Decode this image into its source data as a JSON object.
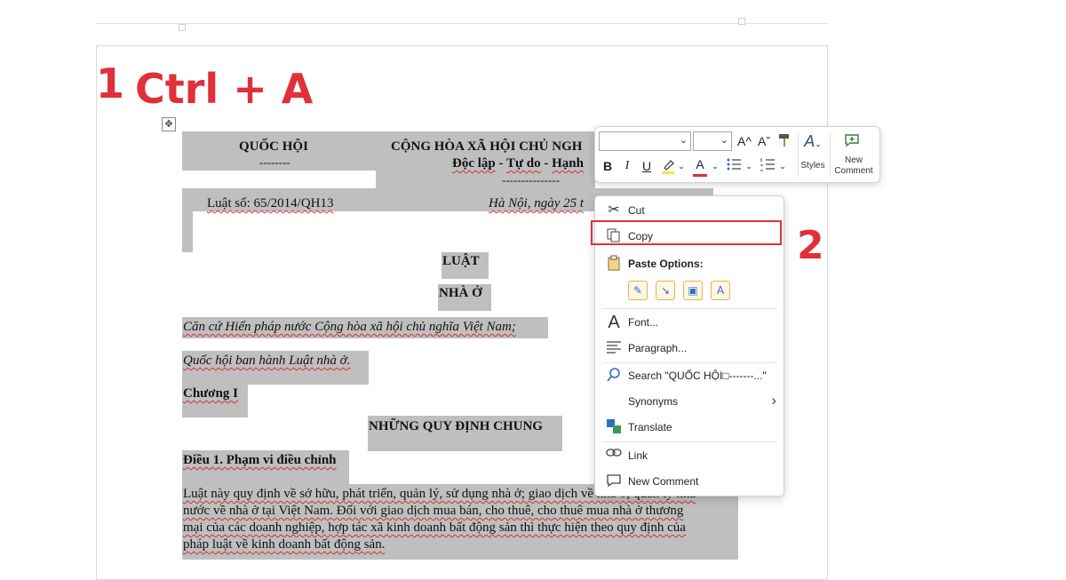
{
  "annotations": {
    "step1_number": "1",
    "step1_text": "Ctrl + A",
    "step2_number": "2"
  },
  "document": {
    "left_header_title": "QUỐC HỘI",
    "left_header_dashes": "--------",
    "right_header_title": "CỘNG HÒA XÃ HỘI CHỦ NGH",
    "motto_a": "Độc lập",
    "motto_dash1": " - ",
    "motto_b": "Tự do",
    "motto_dash2": " - ",
    "motto_c": "Hạnh",
    "motto_dashes": "---------------",
    "law_number": "Luật số: 65/2014/QH13",
    "place_date": "Hà Nội, ngày 25 t",
    "title_law": "LUẬT",
    "title_housing": "NHÀ Ở",
    "basis_line": "Căn cứ Hiến pháp nước Cộng hòa xã hội chủ nghĩa Việt Nam;",
    "enact_line": "Quốc hội ban hành Luật nhà ở.",
    "chapter": "Chương I",
    "chapter_title": "NHỮNG QUY ĐỊNH CHUNG",
    "article_title": "Điều 1. Phạm vi điều chỉnh",
    "body_lines": [
      "Luật này quy định về sở hữu, phát triển, quản lý, sử dụng nhà ở; giao dịch về nhà ở; quản lý nhà",
      "nước về nhà ở tại Việt Nam. Đối với giao dịch mua bán, cho thuê, cho thuê mua nhà ở thương",
      "mại của các doanh nghiệp, hợp tác xã kinh doanh bất động sản thì thực hiện theo quy định của",
      "pháp luật về kinh doanh bất động sản."
    ]
  },
  "mini_toolbar": {
    "font_name_value": "",
    "font_size_value": "",
    "grow_font_label": "A^",
    "shrink_font_label": "Aˇ",
    "bold_label": "B",
    "italic_label": "I",
    "underline_label": "U",
    "font_color_letter": "A",
    "styles_label": "Styles",
    "new_comment_line1": "New",
    "new_comment_line2": "Comment",
    "colors": {
      "highlight": "#f5e642",
      "font_color": "#e0303a",
      "accent": "#2f6fbf"
    }
  },
  "context_menu": {
    "cut": "Cut",
    "copy": "Copy",
    "paste_options": "Paste Options:",
    "font": "Font...",
    "paragraph": "Paragraph...",
    "search": "Search \"QUỐC HỘI□-------...\"",
    "synonyms": "Synonyms",
    "translate": "Translate",
    "link": "Link",
    "new_comment": "New Comment",
    "font_icon_letter": "A",
    "submenu_arrow": "›"
  },
  "colors": {
    "selection": "#bfbfbf",
    "annotation_red": "#e0303a"
  }
}
